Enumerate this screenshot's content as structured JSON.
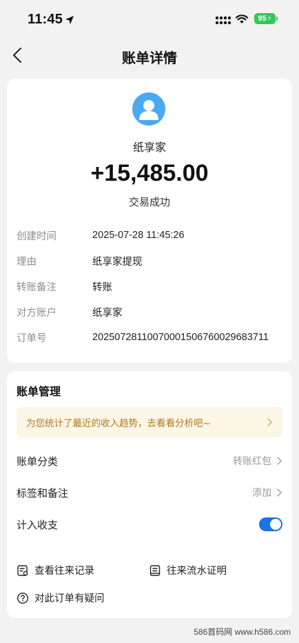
{
  "status_bar": {
    "time": "11:45",
    "battery": "95"
  },
  "nav": {
    "title": "账单详情",
    "back_icon": "chevron-left-icon"
  },
  "transaction": {
    "merchant": "纸享家",
    "amount": "+15,485.00",
    "status": "交易成功",
    "details": [
      {
        "label": "创建时间",
        "value": "2025-07-28 11:45:26"
      },
      {
        "label": "理由",
        "value": "纸享家提现"
      },
      {
        "label": "转账备注",
        "value": "转账"
      },
      {
        "label": "对方账户",
        "value": "纸享家"
      },
      {
        "label": "订单号",
        "value": "20250728110070001506760029683711"
      }
    ],
    "avatar_icon": "user-avatar-icon",
    "avatar_color": "#4aa8f5"
  },
  "management": {
    "title": "账单管理",
    "insight_text": "为您统计了最近的收入趋势，去看看分析吧~",
    "rows": [
      {
        "label": "账单分类",
        "value": "转账红包"
      },
      {
        "label": "标签和备注",
        "value": "添加"
      }
    ],
    "toggle_label": "计入收支",
    "toggle_on": true,
    "links": [
      {
        "label": "查看往来记录",
        "icon": "record-icon"
      },
      {
        "label": "往来流水证明",
        "icon": "statement-icon"
      },
      {
        "label": "对此订单有疑问",
        "icon": "question-icon"
      }
    ],
    "accent_color": "#1a73e8",
    "banner_bg": "#fbf6e5",
    "banner_text_color": "#b07a24"
  },
  "watermark": "586首码网 www.h586.com"
}
